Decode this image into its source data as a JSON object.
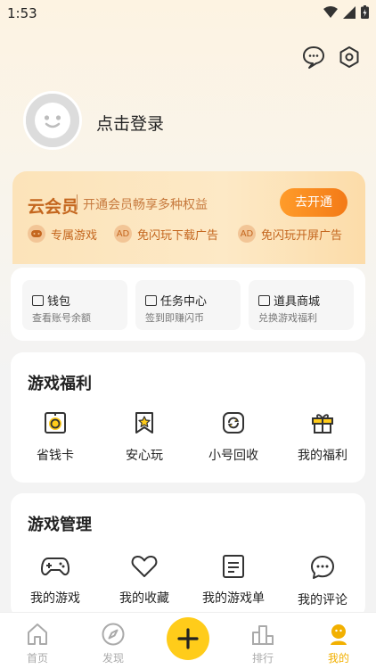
{
  "status": {
    "time": "1:53"
  },
  "profile": {
    "login_label": "点击登录"
  },
  "vip": {
    "title": "云会员",
    "subtitle": "开通会员畅享多种权益",
    "button": "去开通",
    "perks": [
      {
        "label": "专属游戏",
        "icon": "gamepad-icon"
      },
      {
        "label": "免闪玩下载广告",
        "icon": "no-ad-icon"
      },
      {
        "label": "免闪玩开屏广告",
        "icon": "no-ad-icon"
      }
    ]
  },
  "wallet": {
    "items": [
      {
        "title": "钱包",
        "sub": "查看账号余额"
      },
      {
        "title": "任务中心",
        "sub": "签到即赚闪币"
      },
      {
        "title": "道具商城",
        "sub": "兑换游戏福利"
      }
    ]
  },
  "game_welfare": {
    "title": "游戏福利",
    "items": [
      {
        "label": "省钱卡",
        "icon": "coin-card-icon"
      },
      {
        "label": "安心玩",
        "icon": "star-bookmark-icon"
      },
      {
        "label": "小号回收",
        "icon": "recycle-icon"
      },
      {
        "label": "我的福利",
        "icon": "gift-icon"
      }
    ]
  },
  "game_manage": {
    "title": "游戏管理",
    "items": [
      {
        "label": "我的游戏",
        "icon": "gamepad-icon"
      },
      {
        "label": "我的收藏",
        "icon": "heart-icon"
      },
      {
        "label": "我的游戏单",
        "icon": "list-icon"
      },
      {
        "label": "我的评论",
        "icon": "comment-icon"
      }
    ]
  },
  "nav": {
    "items": [
      {
        "label": "首页",
        "icon": "home-icon"
      },
      {
        "label": "发现",
        "icon": "compass-icon"
      },
      {
        "label": "排行",
        "icon": "ranking-icon"
      },
      {
        "label": "我的",
        "icon": "profile-icon"
      }
    ],
    "active_color": "#f2b000",
    "fab_color": "#ffcc1a"
  },
  "colors": {
    "accent": "#f37a17",
    "vip_text": "#c4661e"
  }
}
